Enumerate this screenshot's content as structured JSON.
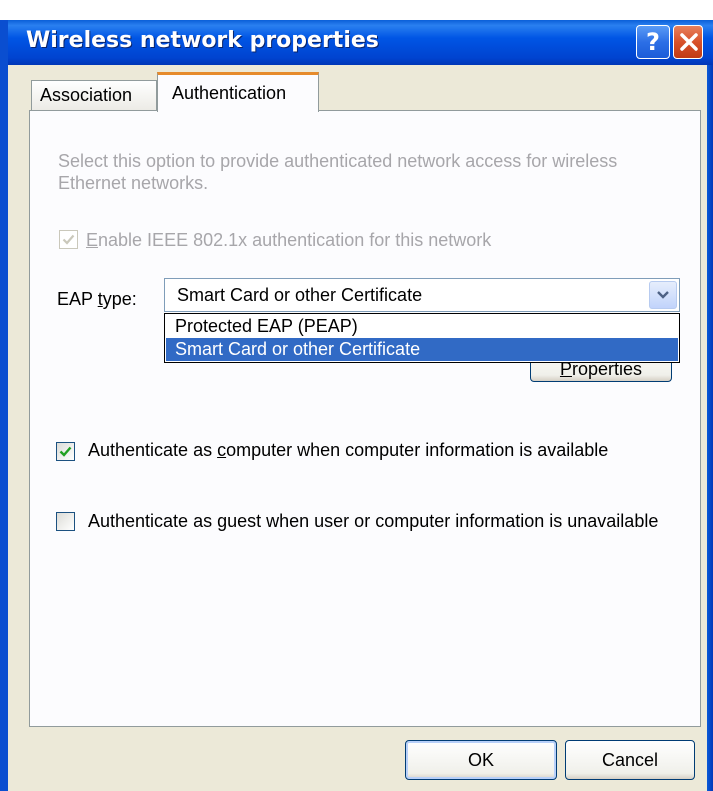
{
  "window": {
    "title": "Wireless network properties",
    "help_glyph": "?",
    "close_icon": "close-icon"
  },
  "tabs": [
    {
      "label": "Association",
      "selected": false
    },
    {
      "label": "Authentication",
      "selected": true
    }
  ],
  "authentication": {
    "description": "Select this option to provide authenticated network access for wireless Ethernet networks.",
    "enable_8021x": {
      "label_prefix": "",
      "label_accel": "E",
      "label_rest": "nable IEEE 802.1x authentication for this network",
      "checked": true,
      "enabled": false
    },
    "eap_type": {
      "label_prefix": "EAP ",
      "label_accel": "t",
      "label_rest": "ype:",
      "selected": "Smart Card or other Certificate",
      "options": [
        "Protected EAP (PEAP)",
        "Smart Card or other Certificate"
      ],
      "highlighted_index": 1
    },
    "properties_button": {
      "label_prefix": "",
      "label_accel": "P",
      "label_rest": "roperties"
    },
    "auth_as_computer": {
      "label_prefix": "Authenticate as ",
      "label_accel": "c",
      "label_rest": "omputer when computer information is available",
      "checked": true
    },
    "auth_as_guest": {
      "label_prefix": "Authenticate as ",
      "label_accel": "g",
      "label_rest": "uest when user or computer information is unavailable",
      "checked": false
    }
  },
  "footer": {
    "ok_label": "OK",
    "cancel_label": "Cancel"
  },
  "colors": {
    "titlebar": "#0055e5",
    "tab_highlight": "#e68b2c",
    "selection": "#316ac5",
    "checkmark": "#21a121",
    "disabled_text": "#a7a6aa"
  }
}
